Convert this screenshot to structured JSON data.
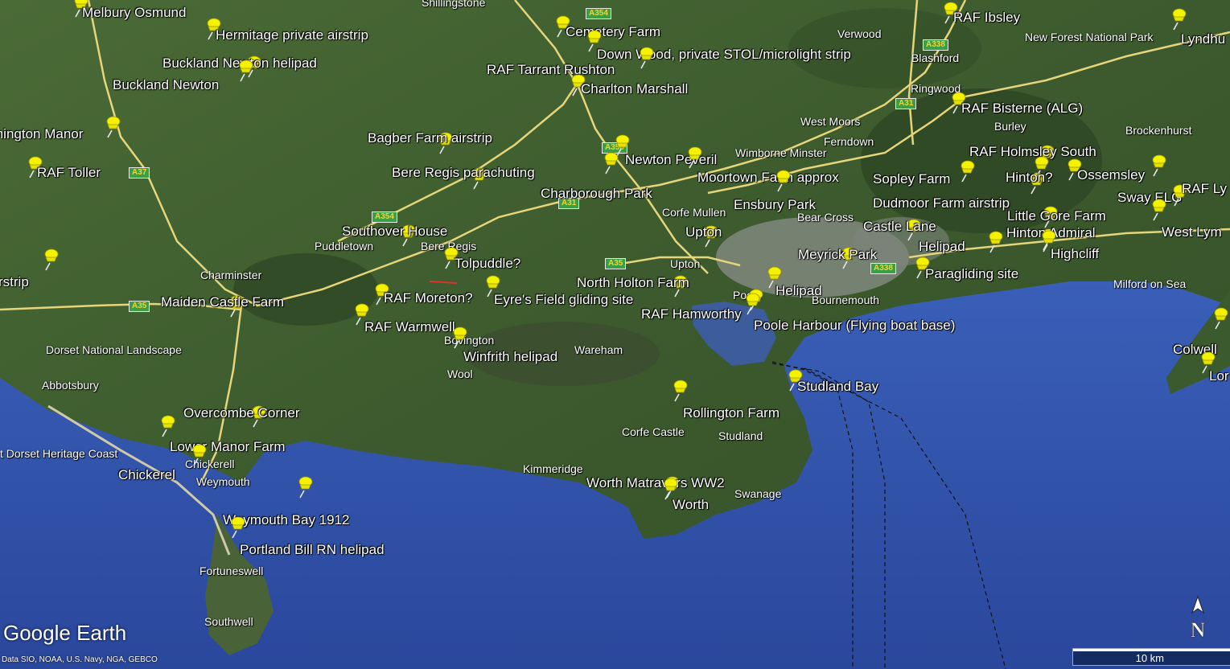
{
  "map": {
    "brand": "Google Earth",
    "attribution": "Data SIO, NOAA, U.S. Navy, NGA, GEBCO",
    "scale_label": "10 km",
    "north_label": "N",
    "colors": {
      "land": "#3f5d2f",
      "sea": "#2f4fa6",
      "roads": "#e9d77a",
      "pin": "#f2f000",
      "label": "#ffffff"
    }
  },
  "placemarks": [
    {
      "label": "Melbury Osmund"
    },
    {
      "label": "Hermitage private airstrip"
    },
    {
      "label": "Buckland Newton helipad"
    },
    {
      "label": "Buckland Newton"
    },
    {
      "label": "mington Manor"
    },
    {
      "label": "RAF Toller"
    },
    {
      "label": "rstrip"
    },
    {
      "label": "Maiden Castle Farm"
    },
    {
      "label": "Cemetery Farm"
    },
    {
      "label": "Down Wood, private STOL/microlight strip"
    },
    {
      "label": "RAF Tarrant Rushton"
    },
    {
      "label": "Charlton Marshall"
    },
    {
      "label": "Bagber Farm airstrip"
    },
    {
      "label": "Bere Regis parachuting"
    },
    {
      "label": "Newton Peveril"
    },
    {
      "label": "Charborough Park"
    },
    {
      "label": "Moortown Farm approx"
    },
    {
      "label": "Southover House"
    },
    {
      "label": "Tolpuddle?"
    },
    {
      "label": "RAF Moreton?"
    },
    {
      "label": "Eyre's Field gliding site"
    },
    {
      "label": "RAF Warmwell"
    },
    {
      "label": "Winfrith helipad"
    },
    {
      "label": "North Holton Farm"
    },
    {
      "label": "RAF Hamworthy"
    },
    {
      "label": "Upton"
    },
    {
      "label": "Ensbury Park"
    },
    {
      "label": "Helipad"
    },
    {
      "label": "Poole Harbour (Flying boat base)"
    },
    {
      "label": "Meyrick Park"
    },
    {
      "label": "Castle Lane"
    },
    {
      "label": "Helipad"
    },
    {
      "label": "Sopley Farm"
    },
    {
      "label": "Dudmoor Farm airstrip"
    },
    {
      "label": "Paragliding site"
    },
    {
      "label": "RAF Ibsley"
    },
    {
      "label": "RAF Bisterne (ALG)"
    },
    {
      "label": "RAF Holmsley South"
    },
    {
      "label": "Hinton?"
    },
    {
      "label": "Ossemsley"
    },
    {
      "label": "Sway ELG"
    },
    {
      "label": "RAF Ly"
    },
    {
      "label": "Little Gore Farm"
    },
    {
      "label": "Hinton Admiral"
    },
    {
      "label": "Highcliff"
    },
    {
      "label": "West Lym"
    },
    {
      "label": "Colwell"
    },
    {
      "label": "Lor"
    },
    {
      "label": "Lyndhu"
    },
    {
      "label": "Studland Bay"
    },
    {
      "label": "Rollington Farm"
    },
    {
      "label": "Worth Matravers WW2"
    },
    {
      "label": "Worth"
    },
    {
      "label": "Overcombe Corner"
    },
    {
      "label": "Lower Manor Farm"
    },
    {
      "label": "Chickerel"
    },
    {
      "label": "Weymouth Bay 1912"
    },
    {
      "label": "Portland Bill RN helipad"
    }
  ],
  "towns": [
    "Shillingstone",
    "Verwood",
    "Blashford",
    "New Forest National Park",
    "Ringwood",
    "West Moors",
    "Burley",
    "Brockenhurst",
    "Ferndown",
    "Wimborne Minster",
    "Corfe Mullen",
    "Bear Cross",
    "Puddletown",
    "Bere Regis",
    "Charminster",
    "Upton",
    "Poole",
    "Bournemouth",
    "Milford on Sea",
    "Dorset National Landscape",
    "Bovington",
    "Wareham",
    "Wool",
    "Abbotsbury",
    "Corfe Castle",
    "Studland",
    "Kimmeridge",
    "Swanage",
    "t Dorset Heritage Coast",
    "Chickerell",
    "Weymouth",
    "Fortuneswell",
    "Southwell"
  ],
  "road_shields": [
    "A354",
    "A338",
    "A31",
    "A350",
    "A37",
    "A354",
    "A31",
    "A35",
    "A338",
    "A35"
  ]
}
